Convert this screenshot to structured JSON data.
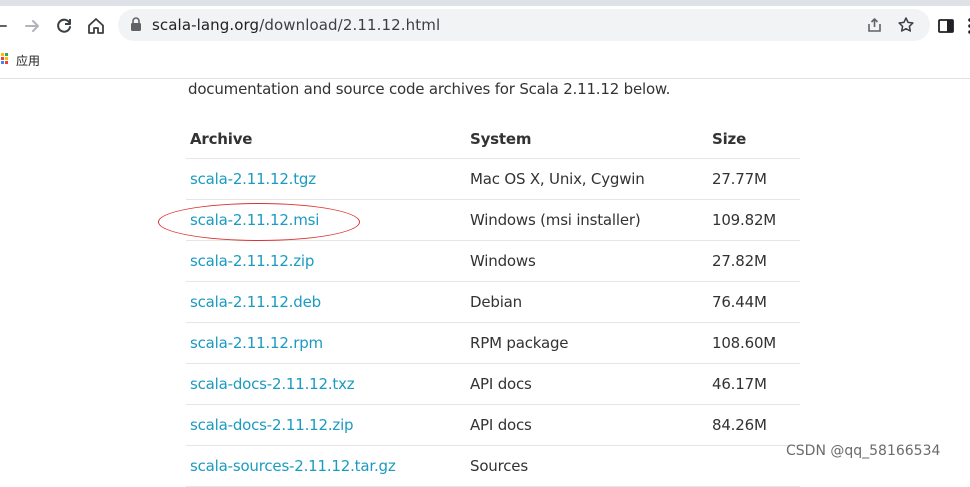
{
  "browser": {
    "url_host": "scala-lang.org",
    "url_path": "/download/2.11.12.html",
    "bookmarks_apps_label": "应用"
  },
  "page": {
    "intro_text": "documentation and source code archives for Scala 2.11.12 below.",
    "table": {
      "headers": [
        "Archive",
        "System",
        "Size"
      ],
      "rows": [
        {
          "archive": "scala-2.11.12.tgz",
          "system": "Mac OS X, Unix, Cygwin",
          "size": "27.77M"
        },
        {
          "archive": "scala-2.11.12.msi",
          "system": "Windows (msi installer)",
          "size": "109.82M"
        },
        {
          "archive": "scala-2.11.12.zip",
          "system": "Windows",
          "size": "27.82M"
        },
        {
          "archive": "scala-2.11.12.deb",
          "system": "Debian",
          "size": "76.44M"
        },
        {
          "archive": "scala-2.11.12.rpm",
          "system": "RPM package",
          "size": "108.60M"
        },
        {
          "archive": "scala-docs-2.11.12.txz",
          "system": "API docs",
          "size": "46.17M"
        },
        {
          "archive": "scala-docs-2.11.12.zip",
          "system": "API docs",
          "size": "84.26M"
        },
        {
          "archive": "scala-sources-2.11.12.tar.gz",
          "system": "Sources",
          "size": ""
        }
      ]
    },
    "highlighted_row": "scala-2.11.12.msi"
  },
  "watermark": "CSDN @qq_58166534",
  "colors": {
    "link": "#1a9bc1",
    "highlight": "#dd3333",
    "omnibox_bg": "#f1f3f4"
  },
  "icons": [
    "back-arrow-icon",
    "forward-arrow-icon",
    "reload-icon",
    "home-icon",
    "lock-icon",
    "share-icon",
    "star-icon",
    "sidebar-icon",
    "menu-icon",
    "apps-grid-icon"
  ]
}
